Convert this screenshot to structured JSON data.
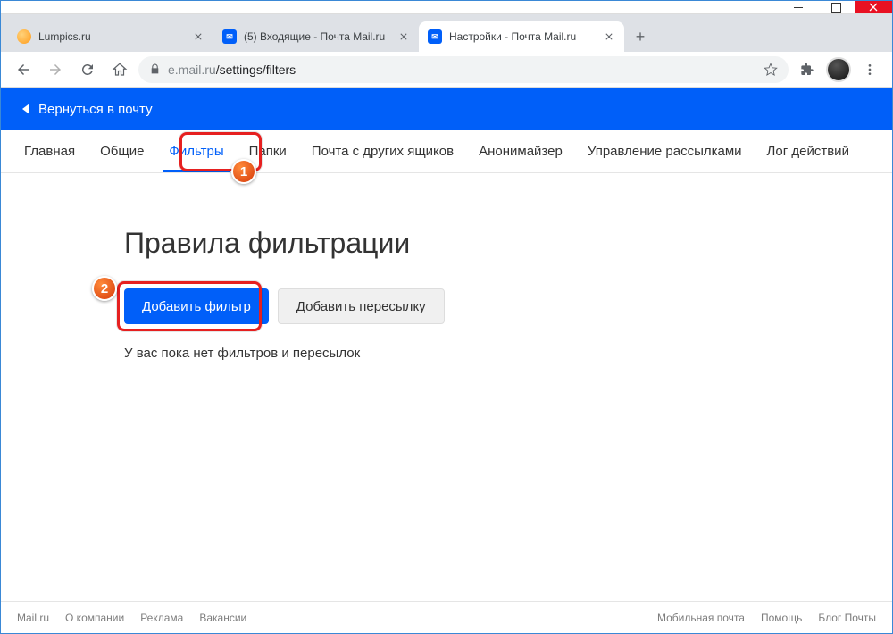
{
  "window": {
    "title": "Настройки - Почта Mail.ru"
  },
  "tabs": [
    {
      "title": "Lumpics.ru",
      "active": false
    },
    {
      "title": "(5) Входящие - Почта Mail.ru",
      "active": false
    },
    {
      "title": "Настройки - Почта Mail.ru",
      "active": true
    }
  ],
  "address": {
    "host": "e.mail.ru",
    "path": "/settings/filters"
  },
  "header": {
    "back_label": "Вернуться в почту"
  },
  "navtabs": {
    "items": [
      "Главная",
      "Общие",
      "Фильтры",
      "Папки",
      "Почта с других ящиков",
      "Анонимайзер",
      "Управление рассылками",
      "Лог действий"
    ],
    "active_index": 2
  },
  "main": {
    "title": "Правила фильтрации",
    "add_filter_label": "Добавить фильтр",
    "add_forward_label": "Добавить пересылку",
    "empty_text": "У вас пока нет фильтров и пересылок"
  },
  "footer": {
    "left": [
      "Mail.ru",
      "О компании",
      "Реклама",
      "Вакансии"
    ],
    "right": [
      "Мобильная почта",
      "Помощь",
      "Блог Почты"
    ]
  },
  "annotations": {
    "badge1": "1",
    "badge2": "2"
  }
}
